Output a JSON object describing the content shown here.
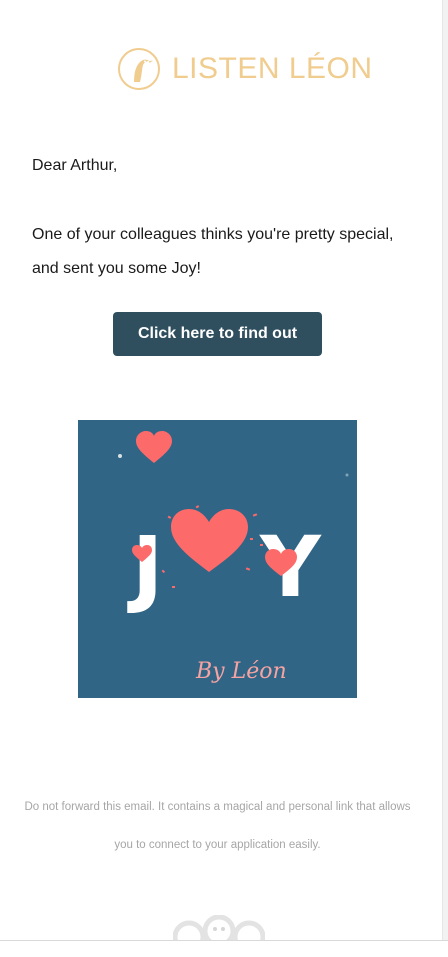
{
  "brand": {
    "name": "LISTEN LÉON",
    "accent": "#f0cc8f",
    "logo_icon": "bird-circle-logo"
  },
  "email": {
    "greeting": "Dear Arthur,",
    "message": "One of your colleagues thinks you're pretty special, and sent you some Joy!",
    "cta_label": "Click here to find out",
    "cta_color": "#2f4f5f"
  },
  "joy_card": {
    "word_left": "J",
    "word_right": "Y",
    "signature": "By Léon",
    "background": "#316586",
    "heart_color": "#fd6a6a",
    "signature_color": "#f6a3a3"
  },
  "footer": {
    "note": "Do not forward this email. It contains a magical and personal link that allows you to connect to your application easily.",
    "mark_icon": "leon-characters-icon"
  }
}
